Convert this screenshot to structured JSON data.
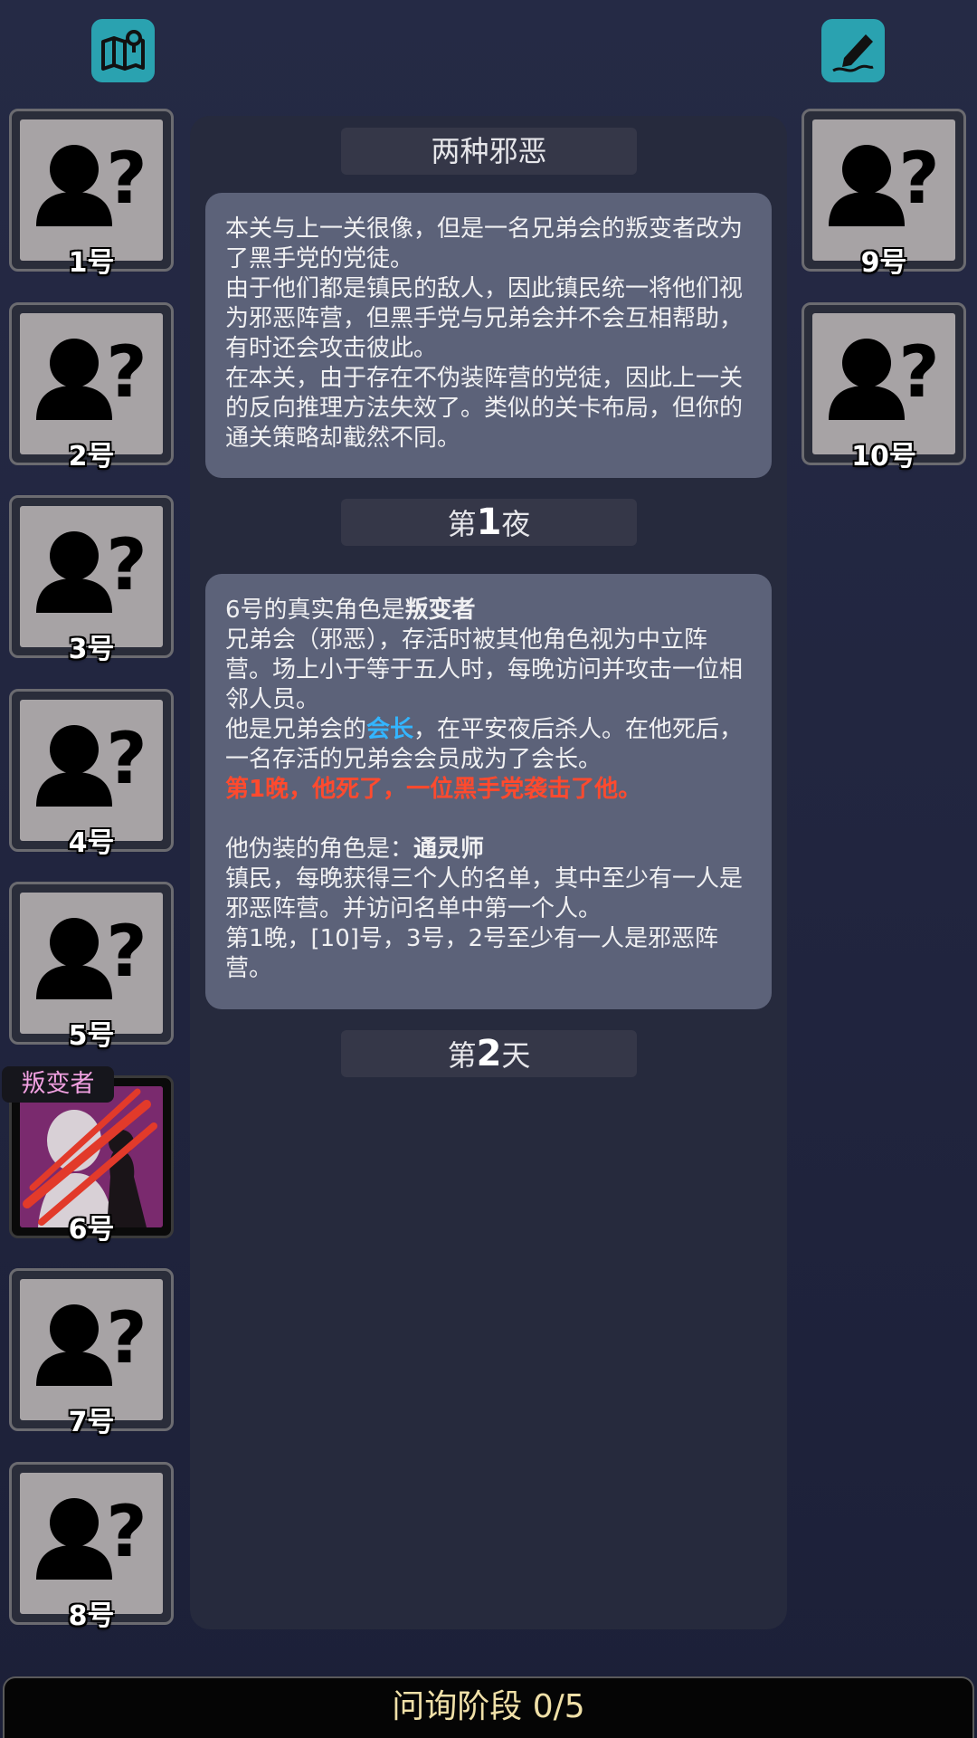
{
  "players_left": [
    {
      "label": "1号",
      "revealed": false
    },
    {
      "label": "2号",
      "revealed": false
    },
    {
      "label": "3号",
      "revealed": false
    },
    {
      "label": "4号",
      "revealed": false
    },
    {
      "label": "5号",
      "revealed": false
    },
    {
      "label": "6号",
      "revealed": true,
      "role_tag": "叛变者"
    },
    {
      "label": "7号",
      "revealed": false
    },
    {
      "label": "8号",
      "revealed": false
    }
  ],
  "players_right": [
    {
      "label": "9号",
      "revealed": false
    },
    {
      "label": "10号",
      "revealed": false
    }
  ],
  "log": {
    "title": "两种邪恶",
    "intro": [
      "本关与上一关很像，但是一名兄弟会的叛变者改为了黑手党的党徒。",
      "由于他们都是镇民的敌人，因此镇民统一将他们视为邪恶阵营，但黑手党与兄弟会并不会互相帮助，有时还会攻击彼此。",
      "在本关，由于存在不伪装阵营的党徒，因此上一关的反向推理方法失效了。类似的关卡布局，但你的通关策略却截然不同。"
    ],
    "night1": {
      "prefix": "第",
      "number": "1",
      "suffix": "夜"
    },
    "night1_msg": {
      "line1_a": "6号的真实角色是",
      "line1_role": "叛变者",
      "line2": "兄弟会（邪恶），存活时被其他角色视为中立阵营。场上小于等于五人时，每晚访问并攻击一位相邻人员。",
      "line3_a": "他是兄弟会的",
      "line3_hl": "会长",
      "line3_b": "，在平安夜后杀人。在他死后，一名存活的兄弟会会员成为了会长。",
      "line4": "第1晚，他死了，一位黑手党袭击了他。",
      "line5_a": "他伪装的角色是：",
      "line5_role": "通灵师",
      "line6": "镇民，每晚获得三个人的名单，其中至少有一人是邪恶阵营。并访问名单中第一个人。",
      "line7": "第1晚，[10]号，3号，2号至少有一人是邪恶阵营。"
    },
    "day2": {
      "prefix": "第",
      "number": "2",
      "suffix": "天"
    }
  },
  "bottom": {
    "phase_label": "问询阶段 0/5"
  },
  "icons": {
    "top_left": "map-icon",
    "top_right": "notes-pen-icon",
    "unknown": "unknown-person-icon"
  },
  "colors": {
    "accent": "#2aa2b0",
    "highlight_blue": "#33b5ff",
    "highlight_red": "#ff4a2e",
    "role_tag": "#f0a0e0"
  }
}
